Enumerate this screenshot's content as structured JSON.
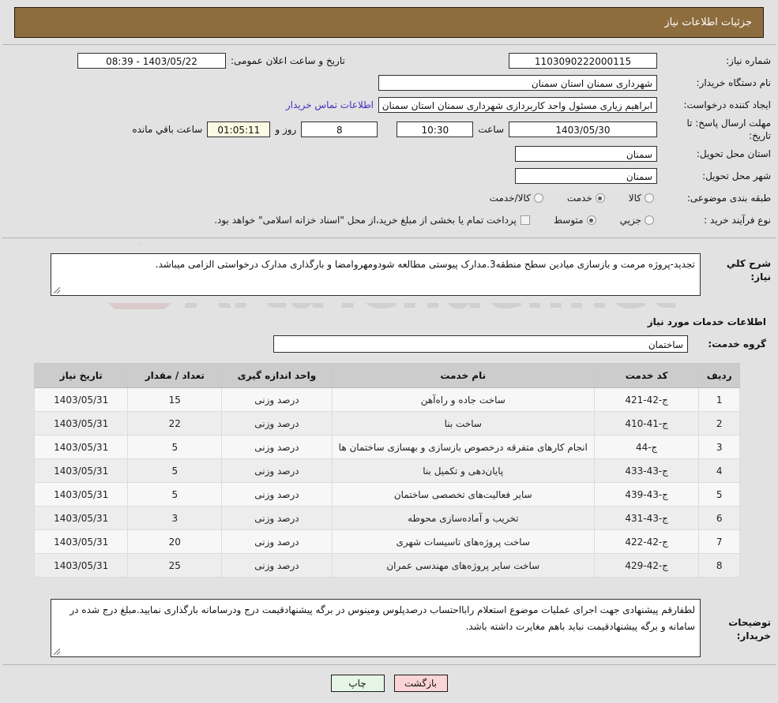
{
  "header": {
    "title": "جزئیات اطلاعات نیاز",
    "bar_color": "#8d6c3e"
  },
  "form": {
    "need_number_label": "شماره نیاز:",
    "need_number_value": "1103090222000115",
    "public_announce_label": "تاریخ و ساعت اعلان عمومی:",
    "public_announce_value": "1403/05/22 - 08:39",
    "buyer_org_label": "نام دستگاه خریدار:",
    "buyer_org_value": "شهرداری سمنان استان سمنان",
    "requester_label": "ایجاد کننده درخواست:",
    "requester_value": "ابراهیم زیاری مسئول واحد کاربردازی شهرداری سمنان استان سمنان",
    "contact_link": "اطلاعات تماس خریدار",
    "deadline_label": "مهلت ارسال پاسخ: تا تاریخ:",
    "deadline_date": "1403/05/30",
    "hour_label": "ساعت",
    "hour_value": "10:30",
    "days_value": "8",
    "days_suffix": "روز و",
    "countdown_value": "01:05:11",
    "countdown_suffix": "ساعت باقي مانده",
    "province_label": "استان محل تحویل:",
    "province_value": "سمنان",
    "city_label": "شهر محل تحویل:",
    "city_value": "سمنان",
    "category_label": "طبقه بندی موضوعی:",
    "category_options": [
      {
        "label": "کالا",
        "selected": false
      },
      {
        "label": "خدمت",
        "selected": true
      },
      {
        "label": "کالا/خدمت",
        "selected": false
      }
    ],
    "process_label": "نوع فرآیند خرید :",
    "process_options": [
      {
        "label": "جزیي",
        "selected": false
      },
      {
        "label": "متوسط",
        "selected": true
      }
    ],
    "treasury_checkbox_label": "پرداخت تمام یا بخشی از مبلغ خرید،از محل \"اسناد خزانه اسلامی\" خواهد بود.",
    "treasury_checked": false
  },
  "description": {
    "label": "شرح کلي نیاز:",
    "text": "تجدید-پروژه مرمت و بازسازی میادین سطح منطقه3.مدارک پیوستی مطالعه شودومهروامضا و بارگذاری مدارک درخواستی الزامی میباشد."
  },
  "services": {
    "heading": "اطلاعات خدمات مورد نیاز",
    "group_label": "گروه خدمت:",
    "group_value": "ساختمان",
    "table": {
      "columns": [
        "ردیف",
        "کد خدمت",
        "نام خدمت",
        "واحد اندازه گیری",
        "تعداد / مقدار",
        "تاریخ نیاز"
      ],
      "rows": [
        {
          "row": "1",
          "code": "ج-42-421",
          "name": "ساخت جاده و راه‌آهن",
          "unit": "درصد وزنی",
          "qty": "15",
          "date": "1403/05/31"
        },
        {
          "row": "2",
          "code": "ج-41-410",
          "name": "ساخت بنا",
          "unit": "درصد وزنی",
          "qty": "22",
          "date": "1403/05/31"
        },
        {
          "row": "3",
          "code": "ج-44",
          "name": "انجام کارهای متفرقه درخصوص بازسازی و بهسازی ساختمان ها",
          "unit": "درصد وزنی",
          "qty": "5",
          "date": "1403/05/31"
        },
        {
          "row": "4",
          "code": "ج-43-433",
          "name": "پایان‌دهی و تکمیل بنا",
          "unit": "درصد وزنی",
          "qty": "5",
          "date": "1403/05/31"
        },
        {
          "row": "5",
          "code": "ج-43-439",
          "name": "سایر فعالیت‌های تخصصی ساختمان",
          "unit": "درصد وزنی",
          "qty": "5",
          "date": "1403/05/31"
        },
        {
          "row": "6",
          "code": "ج-43-431",
          "name": "تخریب و آماده‌سازی محوطه",
          "unit": "درصد وزنی",
          "qty": "3",
          "date": "1403/05/31"
        },
        {
          "row": "7",
          "code": "ج-42-422",
          "name": "ساخت پروژه‌های تاسیسات شهری",
          "unit": "درصد وزنی",
          "qty": "20",
          "date": "1403/05/31"
        },
        {
          "row": "8",
          "code": "ج-42-429",
          "name": "ساخت سایر پروژه‌های مهندسی عمران",
          "unit": "درصد وزنی",
          "qty": "25",
          "date": "1403/05/31"
        }
      ]
    }
  },
  "buyer_notes": {
    "label": "توضیحات خریدار:",
    "text": "لطفارقم پیشنهادی جهت اجرای عملیات موضوع استعلام رابااحتساب درصدپلوس ومینوس در برگه پیشنهادقیمت درج ودرسامانه بارگذاری نمایید.مبلغ درج شده در سامانه و برگه پیشنهادقیمت نباید باهم مغایرت داشته باشد."
  },
  "footer": {
    "print_label": "چاپ",
    "back_label": "بازگشت"
  },
  "watermark": {
    "text": "ArtaTender.net"
  }
}
